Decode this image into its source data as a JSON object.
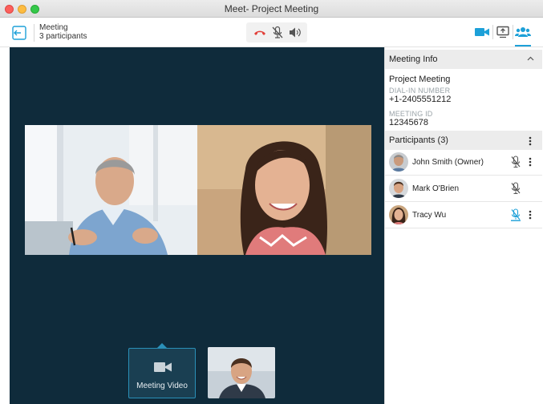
{
  "window": {
    "title": "Meet- Project Meeting"
  },
  "toolbar": {
    "meeting_label": "Meeting",
    "participants_count": "3 participants",
    "controls": [
      "end-call-icon",
      "mic-muted-icon",
      "speaker-icon"
    ],
    "right_icons": [
      "video-camera-icon",
      "screen-share-icon",
      "participants-icon"
    ],
    "accent_color": "#1da0d8",
    "end_call_color": "#e2403a"
  },
  "stage": {
    "background": "#0f2b3b",
    "thumbnails": {
      "meeting_video_label": "Meeting Video"
    }
  },
  "panel": {
    "meeting_info": {
      "header": "Meeting Info",
      "title": "Project Meeting",
      "dial_in_label": "DIAL-IN NUMBER",
      "dial_in_number": "+1-2405551212",
      "meeting_id_label": "MEETING ID",
      "meeting_id": "12345678"
    },
    "participants": {
      "header": "Participants (3)",
      "list": [
        {
          "name": "John Smith (Owner)",
          "mic": "muted"
        },
        {
          "name": "Mark O'Brien",
          "mic": "muted"
        },
        {
          "name": "Tracy Wu",
          "mic": "active"
        }
      ]
    }
  }
}
